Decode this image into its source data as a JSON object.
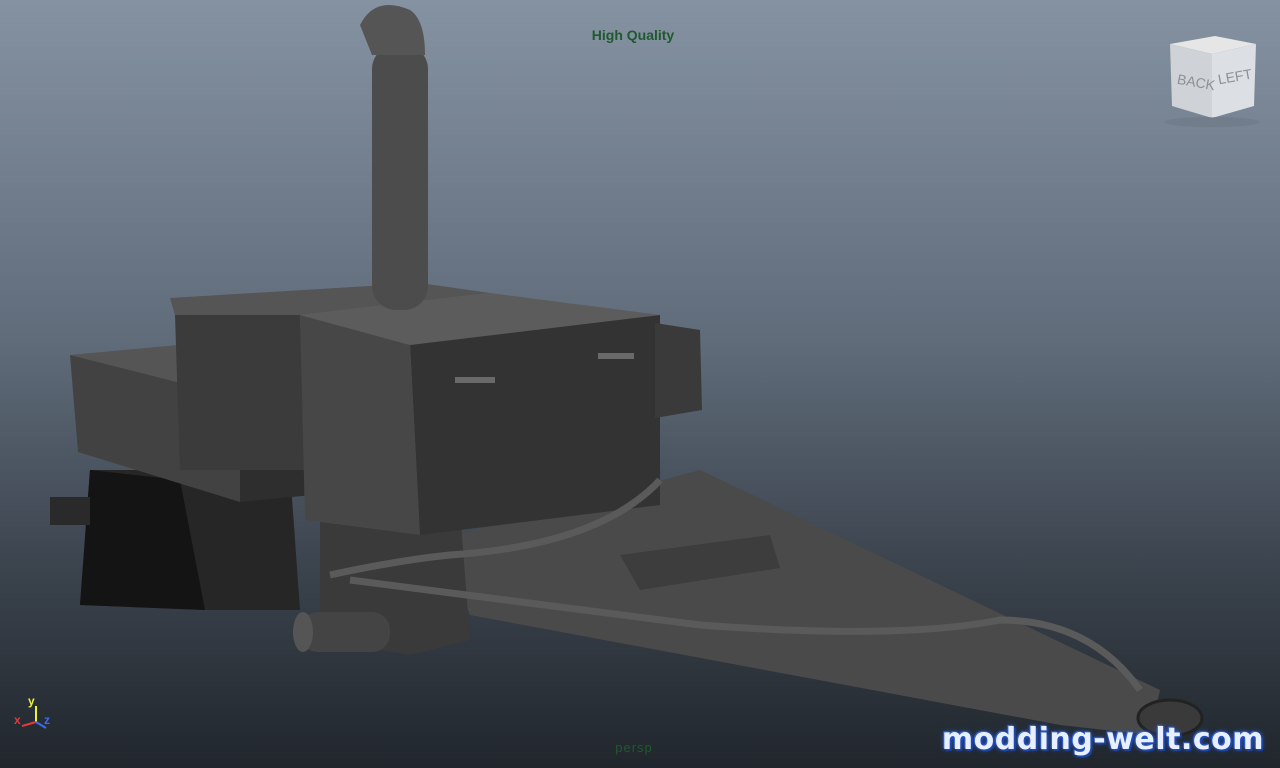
{
  "viewport": {
    "display_mode": "High Quality",
    "camera_name": "persp"
  },
  "viewcube": {
    "face_back": "BACK",
    "face_left": "LEFT"
  },
  "axis_gizmo": {
    "x_label": "x",
    "y_label": "y",
    "z_label": "z",
    "x_color": "#e23a3a",
    "y_color": "#e9f23c",
    "z_color": "#3a6cf0"
  },
  "watermark": {
    "text": "modding-welt.com"
  },
  "colors": {
    "background_top": "#8592a2",
    "background_bottom": "#20262c",
    "model_gray": "#4a4a4a",
    "hud_text": "#1f5a2e"
  }
}
